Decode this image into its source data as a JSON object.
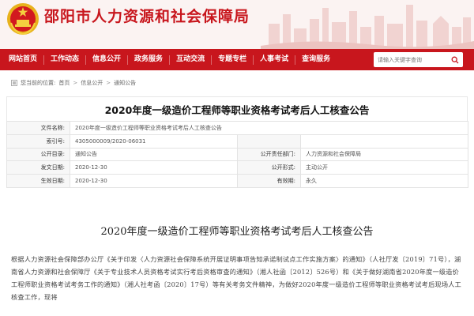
{
  "header": {
    "site_title": "邵阳市人力资源和社会保障局"
  },
  "nav": {
    "items": [
      {
        "label": "网站首页"
      },
      {
        "label": "工作动态"
      },
      {
        "label": "信息公开"
      },
      {
        "label": "政务服务"
      },
      {
        "label": "互动交流"
      },
      {
        "label": "专题专栏"
      },
      {
        "label": "人事考试"
      },
      {
        "label": "查询服务"
      }
    ],
    "search_placeholder": "请输入关键字查询"
  },
  "breadcrumb": {
    "prefix": "您当前的位置:",
    "items": [
      "首页",
      "信息公开",
      "通知公告"
    ]
  },
  "title": "2020年度一级造价工程师等职业资格考试考后人工核查公告",
  "info": {
    "doc_name_label": "文件名称:",
    "doc_name": "2020年度一级造价工程师等职业资格考试考后人工核查公告",
    "index_label": "索引号:",
    "index": "4305000009/2020-06031",
    "catalog_label": "公开目录:",
    "catalog": "通知公告",
    "resp_label": "公开责任部门:",
    "resp": "人力资源和社会保障局",
    "date_label": "发文日期:",
    "date": "2020-12-30",
    "form_label": "公开形式:",
    "form": "主动公开",
    "effective_label": "生效日期:",
    "effective": "2020-12-30",
    "validity_label": "有效期:",
    "validity": "永久"
  },
  "article": {
    "title": "2020年度一级造价工程师等职业资格考试考后人工核查公告",
    "body": "根据人力资源社会保障部办公厅《关于印发〈人力资源社会保障系统开展证明事项告知承诺制试点工作实施方案〉的通知》（人社厅发〔2019〕71号），湖南省人力资源和社会保障厅《关于专业技术人员资格考试实行考后资格审查的通知》（湘人社函〔2012〕526号）和《关于做好湖南省2020年度一级造价工程师职业资格考试考务工作的通知》（湘人社考函〔2020〕17号）等有关考务文件精神，为做好2020年度一级造价工程师等职业资格考试考后现场人工核查工作，现将"
  },
  "colors": {
    "brand_red": "#c8161d",
    "header_bg": "#fbf3f2"
  }
}
